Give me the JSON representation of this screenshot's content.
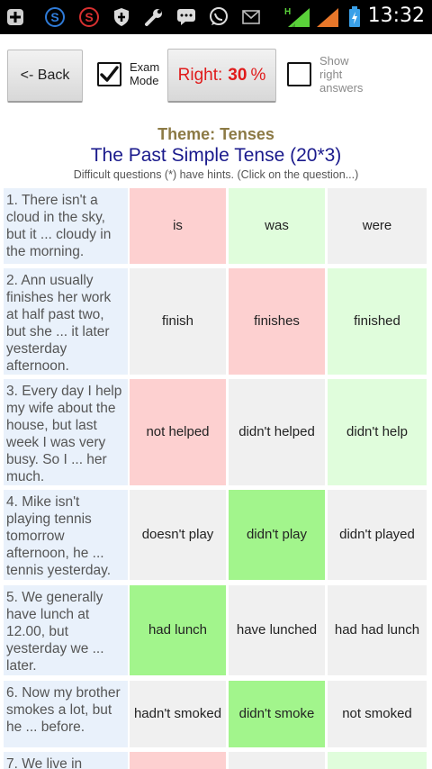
{
  "status_bar": {
    "time": "13:32",
    "network_label": "H",
    "icons": [
      "add-icon",
      "skype-icon",
      "s-app-icon",
      "shield-icon",
      "wrench-icon",
      "chat-icon",
      "whatsapp-icon",
      "mail-icon",
      "signal-icon",
      "signal-icon",
      "battery-icon"
    ]
  },
  "toolbar": {
    "back_label": "<- Back",
    "exam_mode_label": "Exam Mode",
    "exam_mode_checked": true,
    "right_label": "Right:",
    "right_value": "30",
    "right_unit": "%",
    "show_answers_label": "Show right answers",
    "show_answers_checked": false
  },
  "header": {
    "theme": "Theme: Tenses",
    "title": "The Past Simple Tense (20*3)",
    "hint": "Difficult questions (*) have hints. (Click on the question...)"
  },
  "questions": [
    {
      "text": "1. There isn't a cloud in the sky, but it ... cloudy in the morning.",
      "answers": [
        {
          "label": "is",
          "state": "red"
        },
        {
          "label": "was",
          "state": "lgreen"
        },
        {
          "label": "were",
          "state": "gray"
        }
      ]
    },
    {
      "text": "2. Ann usually finishes her work at half past two, but she ... it later yesterday afternoon.",
      "answers": [
        {
          "label": "finish",
          "state": "gray"
        },
        {
          "label": "finishes",
          "state": "red"
        },
        {
          "label": "finished",
          "state": "lgreen"
        }
      ]
    },
    {
      "text": "3. Every day I help my wife about the house, but last week I was very busy. So I ... her much.",
      "answers": [
        {
          "label": "not helped",
          "state": "red"
        },
        {
          "label": "didn't helped",
          "state": "gray"
        },
        {
          "label": "didn't help",
          "state": "lgreen"
        }
      ]
    },
    {
      "text": "4. Mike isn't playing tennis tomorrow afternoon, he ... tennis yesterday.",
      "answers": [
        {
          "label": "doesn't play",
          "state": "gray"
        },
        {
          "label": "didn't play",
          "state": "green"
        },
        {
          "label": "didn't played",
          "state": "gray"
        }
      ]
    },
    {
      "text": "5. We generally have lunch at 12.00, but yesterday we ... later.",
      "answers": [
        {
          "label": "had lunch",
          "state": "green"
        },
        {
          "label": "have lunched",
          "state": "gray"
        },
        {
          "label": "had had lunch",
          "state": "gray"
        }
      ]
    },
    {
      "text": "6. Now my brother smokes a lot, but he ... before.",
      "answers": [
        {
          "label": "hadn't smoked",
          "state": "gray"
        },
        {
          "label": "didn't smoke",
          "state": "green"
        },
        {
          "label": "not smoked",
          "state": "gray"
        }
      ]
    },
    {
      "text": "7. We live in",
      "answers": [
        {
          "label": "",
          "state": "red"
        },
        {
          "label": "",
          "state": "gray"
        },
        {
          "label": "",
          "state": "lgreen"
        }
      ]
    }
  ],
  "colors": {
    "red": "#fdd0d0",
    "green": "#a2f58c",
    "light_green": "#e0fddc",
    "gray": "#f0f0f0",
    "question_bg": "#e9f1fb",
    "title": "#1a1a8c",
    "theme": "#8c7a45",
    "right_text": "#e01b1b"
  }
}
